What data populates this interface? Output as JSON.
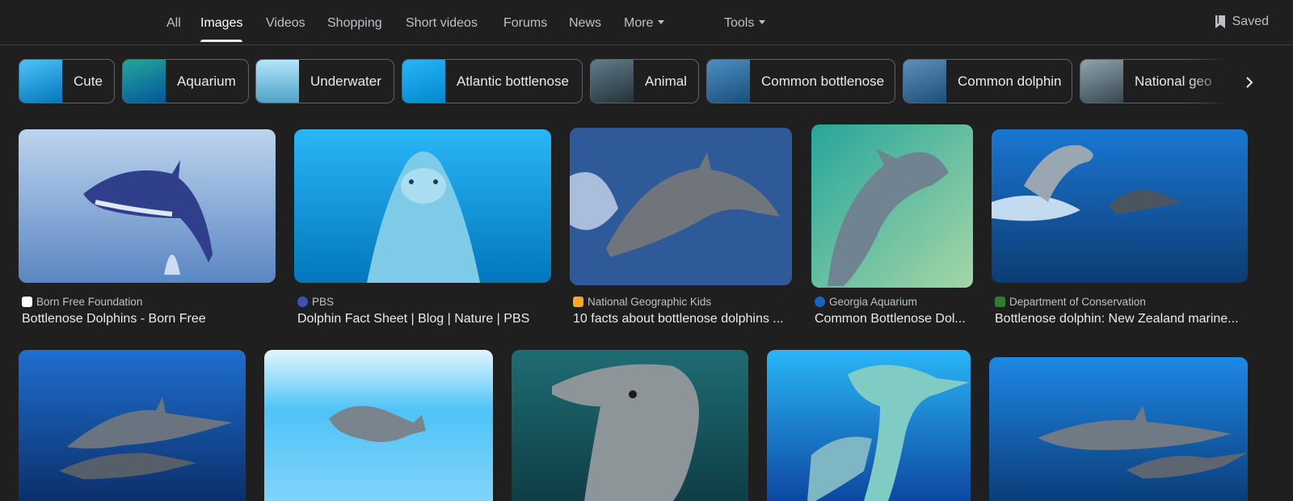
{
  "nav": {
    "tabs": [
      {
        "label": "All"
      },
      {
        "label": "Images"
      },
      {
        "label": "Videos"
      },
      {
        "label": "Shopping"
      },
      {
        "label": "Short videos"
      },
      {
        "label": "Forums"
      },
      {
        "label": "News"
      },
      {
        "label": "More"
      }
    ],
    "active_tab": "Images",
    "tools_label": "Tools",
    "saved_label": "Saved"
  },
  "chips": [
    {
      "label": "Cute"
    },
    {
      "label": "Aquarium"
    },
    {
      "label": "Underwater"
    },
    {
      "label": "Atlantic bottlenose"
    },
    {
      "label": "Animal"
    },
    {
      "label": "Common bottlenose"
    },
    {
      "label": "Common dolphin"
    },
    {
      "label": "National geo"
    }
  ],
  "results": [
    {
      "source": "Born Free Foundation",
      "title": "Bottlenose Dolphins - Born Free"
    },
    {
      "source": "PBS",
      "title": "Dolphin Fact Sheet | Blog | Nature | PBS"
    },
    {
      "source": "National Geographic Kids",
      "title": "10 facts about bottlenose dolphins ..."
    },
    {
      "source": "Georgia Aquarium",
      "title": "Common Bottlenose Dol..."
    },
    {
      "source": "Department of Conservation",
      "title": "Bottlenose dolphin: New Zealand marine..."
    },
    {},
    {},
    {},
    {},
    {}
  ],
  "colors": {
    "background": "#1f1f1f",
    "text_primary": "#e8eaed",
    "text_secondary": "#bdc1c6",
    "border": "#5f6368"
  }
}
